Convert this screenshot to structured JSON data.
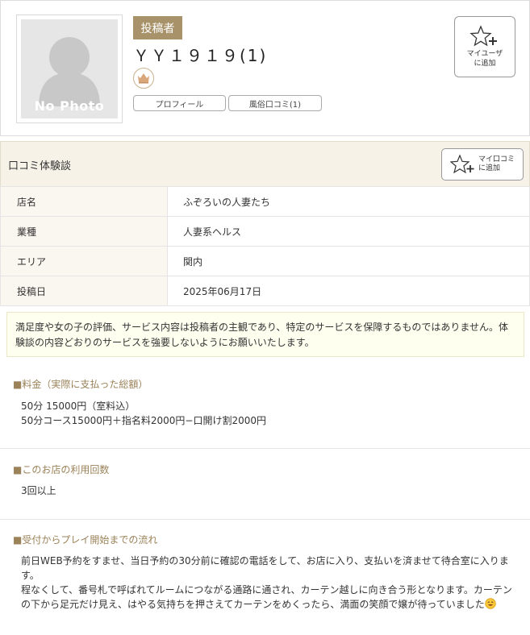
{
  "profile": {
    "no_photo_text": "No Photo",
    "badge": "投稿者",
    "name": "ＹＹ１９１９(1)",
    "profile_button": "プロフィール",
    "reviews_button": "風俗口コミ(1)",
    "my_user_button_line1": "マイユーザ",
    "my_user_button_line2": "に追加"
  },
  "review": {
    "title": "口コミ体験談",
    "my_review_line1": "マイ口コミ",
    "my_review_line2": "に追加"
  },
  "info": [
    {
      "key": "店名",
      "value": "ふぞろいの人妻たち"
    },
    {
      "key": "業種",
      "value": "人妻系ヘルス"
    },
    {
      "key": "エリア",
      "value": "関内"
    },
    {
      "key": "投稿日",
      "value": "2025年06月17日"
    }
  ],
  "disclaimer": "満足度や女の子の評価、サービス内容は投稿者の主観であり、特定のサービスを保障するものではありません。体験談の内容どおりのサービスを強要しないようにお願いいたします。",
  "sections": {
    "price": {
      "title": "■料金（実際に支払った総額）",
      "line1": "50分 15000円（室料込）",
      "line2": "50分コース15000円＋指名料2000円−口開け割2000円"
    },
    "visits": {
      "title": "■このお店の利用回数",
      "line1": "3回以上"
    },
    "flow": {
      "title": "■受付からプレイ開始までの流れ",
      "para1": "前日WEB予約をすませ、当日予約の30分前に確認の電話をして、お店に入り、支払いを済ませて待合室に入ります。",
      "para2": "程なくして、番号札で呼ばれてルームにつながる通路に通され、カーテン越しに向き合う形となります。カーテンの下から足元だけ見え、はやる気持ちを押さえてカーテンをめくったら、満面の笑顔で嬢が待っていました"
    }
  },
  "colors": {
    "badge": "#a8926a",
    "section_title": "#9b8258",
    "header_bg": "#f6f2e8",
    "disclaimer_bg": "#fffff0"
  },
  "icons": {
    "avatar": "person-silhouette-icon",
    "crown": "crown-icon",
    "star_add": "star-plus-icon",
    "smile": "smiling-face-emoji"
  }
}
